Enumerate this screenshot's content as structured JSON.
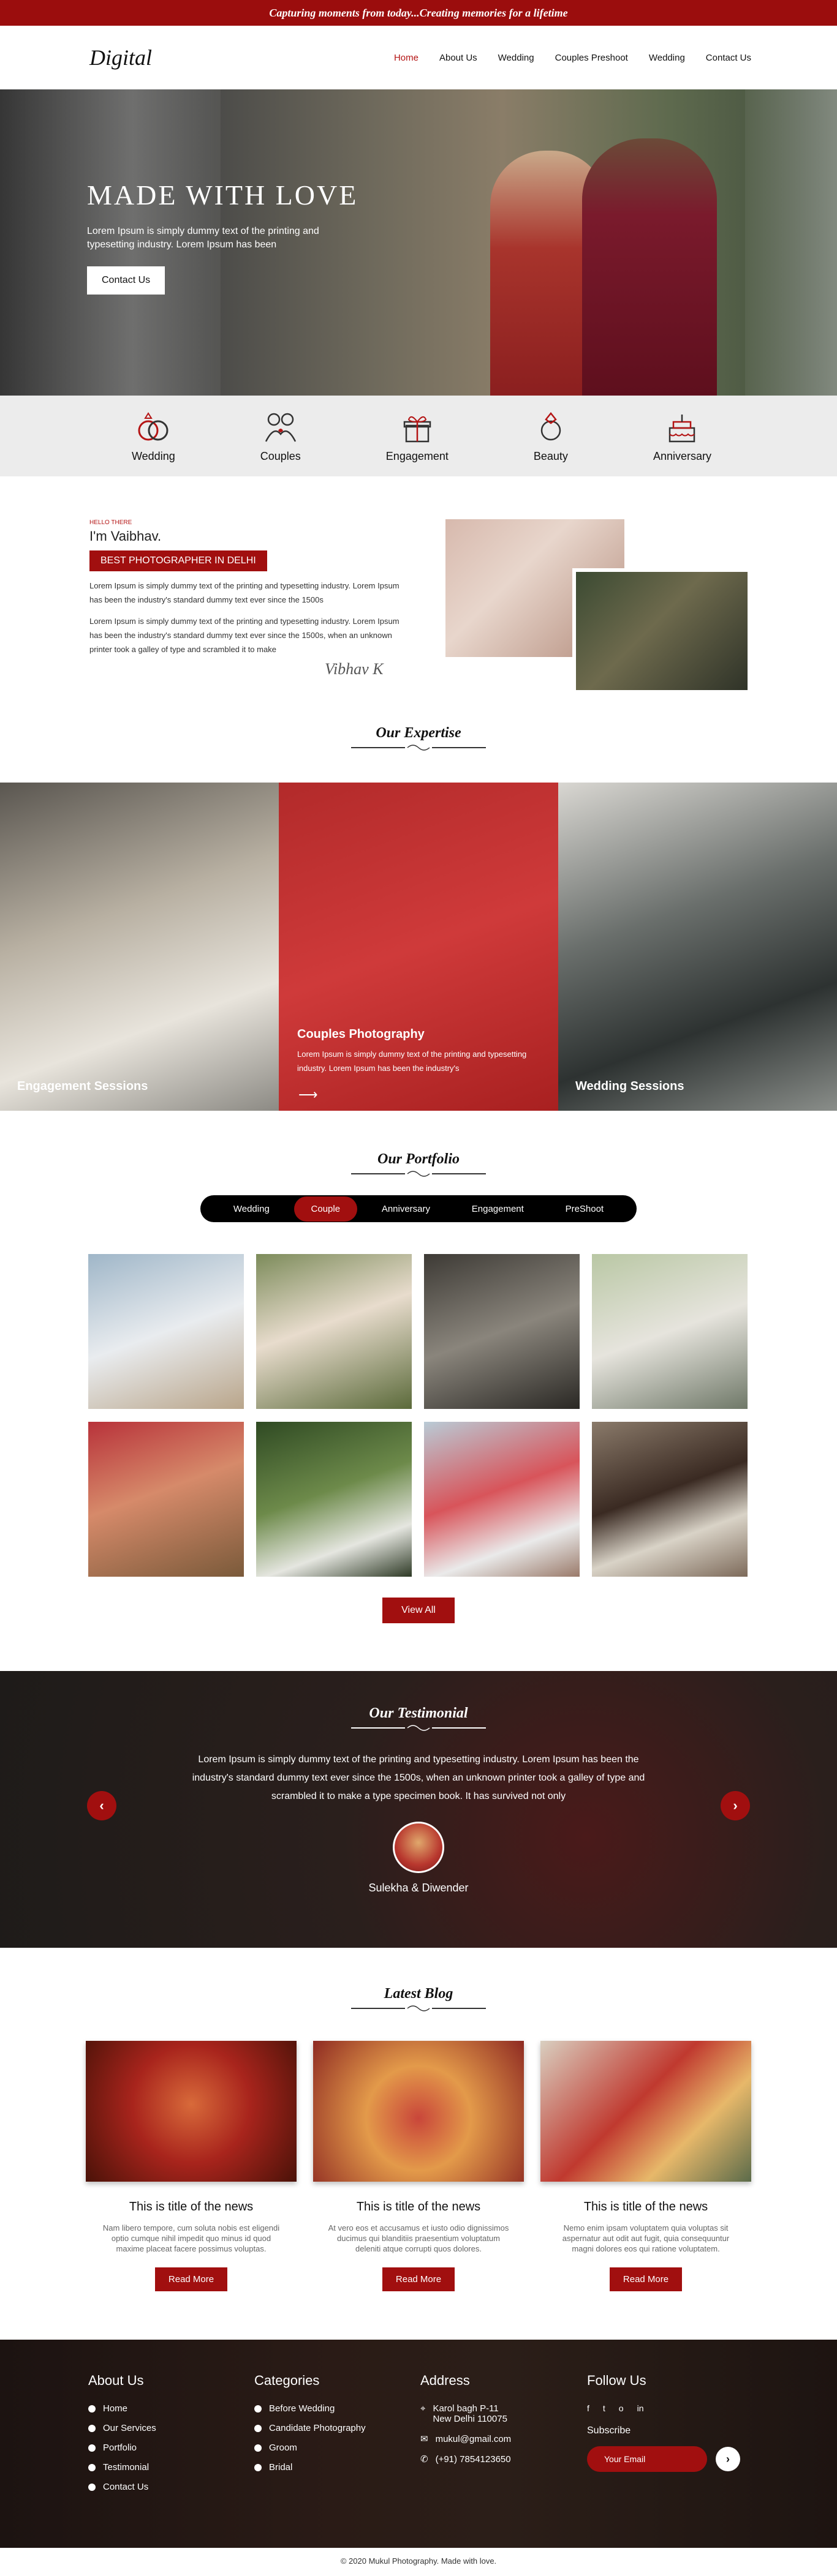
{
  "topbar": {
    "tagline": "Capturing moments from today...Creating memories for a lifetime"
  },
  "nav": {
    "logo": "Digital",
    "items": [
      {
        "label": "Home"
      },
      {
        "label": "About Us"
      },
      {
        "label": "Wedding"
      },
      {
        "label": "Couples Preshoot"
      },
      {
        "label": "Wedding"
      },
      {
        "label": "Contact Us"
      }
    ]
  },
  "hero": {
    "title": "MADE WITH LOVE",
    "subtitle": "Lorem Ipsum is simply dummy text of the printing and typesetting industry. Lorem Ipsum has been",
    "button": "Contact Us"
  },
  "services": [
    {
      "label": "Wedding",
      "icon": "rings-icon"
    },
    {
      "label": "Couples",
      "icon": "couple-icon"
    },
    {
      "label": "Engagement",
      "icon": "gift-icon"
    },
    {
      "label": "Beauty",
      "icon": "ring-icon"
    },
    {
      "label": "Anniversary",
      "icon": "cake-icon"
    }
  ],
  "about": {
    "hello": "HELLO THERE",
    "name": "I'm  Vaibhav.",
    "badge": "BEST PHOTOGRAPHER IN DELHI",
    "para1": "Lorem Ipsum is simply dummy text of the printing and typesetting industry. Lorem Ipsum has been the industry's standard dummy text ever since the 1500s",
    "para2": "Lorem Ipsum is simply dummy text of the printing and typesetting industry. Lorem Ipsum has been the industry's standard dummy text ever since the 1500s, when an unknown printer took a galley of type and scrambled it to make",
    "signature": "Vibhav K"
  },
  "expertise": {
    "title": "Our Expertise",
    "items": [
      {
        "label": "Engagement Sessions"
      },
      {
        "title": "Couples Photography",
        "text": "Lorem Ipsum is simply dummy text of the printing and typesetting industry. Lorem Ipsum has been the industry's"
      },
      {
        "label": "Wedding Sessions"
      }
    ]
  },
  "portfolio": {
    "title": "Our Portfolio",
    "tabs": [
      {
        "label": "Wedding"
      },
      {
        "label": "Couple"
      },
      {
        "label": "Anniversary"
      },
      {
        "label": "Engagement"
      },
      {
        "label": "PreShoot"
      }
    ],
    "active_tab": "Couple",
    "button": "View All"
  },
  "testimonial": {
    "title": "Our Testimonial",
    "quote": "Lorem Ipsum is simply dummy text of the printing and typesetting industry. Lorem Ipsum has been the industry's standard dummy text ever since the 1500s, when an unknown printer took a galley of type and scrambled it to make a type specimen book. It has survived not only",
    "name": "Sulekha & Diwender"
  },
  "blog": {
    "title": "Latest Blog",
    "cards": [
      {
        "title": "This is title of the news",
        "text": "Nam libero tempore, cum soluta nobis est eligendi optio cumque nihil impedit quo minus id quod maxime placeat facere possimus voluptas.",
        "button": "Read More"
      },
      {
        "title": "This is title of the news",
        "text": "At vero eos et accusamus et iusto odio dignissimos ducimus qui blanditiis praesentium voluptatum deleniti atque corrupti quos dolores.",
        "button": "Read More"
      },
      {
        "title": "This is title of the news",
        "text": "Nemo enim ipsam voluptatem quia voluptas sit aspernatur aut odit aut fugit, quia consequuntur magni dolores eos qui ratione voluptatem.",
        "button": "Read More"
      }
    ]
  },
  "footer": {
    "about": {
      "title": "About Us",
      "links": [
        "Home",
        "Our Services",
        "Portfolio",
        "Testimonial",
        "Contact Us"
      ]
    },
    "categories": {
      "title": "Categories",
      "links": [
        "Before Wedding",
        "Candidate Photography",
        "Groom",
        "Bridal"
      ]
    },
    "address": {
      "title": "Address",
      "line1": "Karol bagh P-11",
      "line2": "New Delhi 110075",
      "email": "mukul@gmail.com",
      "phone": "(+91) 7854123650"
    },
    "follow": {
      "title": "Follow Us",
      "social": [
        "f",
        "t",
        "o",
        "in"
      ],
      "subscribe": "Subscribe",
      "placeholder": "Your Email"
    },
    "copyright": "© 2020 Mukul Photography. Made with love."
  },
  "colors": {
    "accent": "#a10f0f",
    "dark": "#1e1b19"
  }
}
